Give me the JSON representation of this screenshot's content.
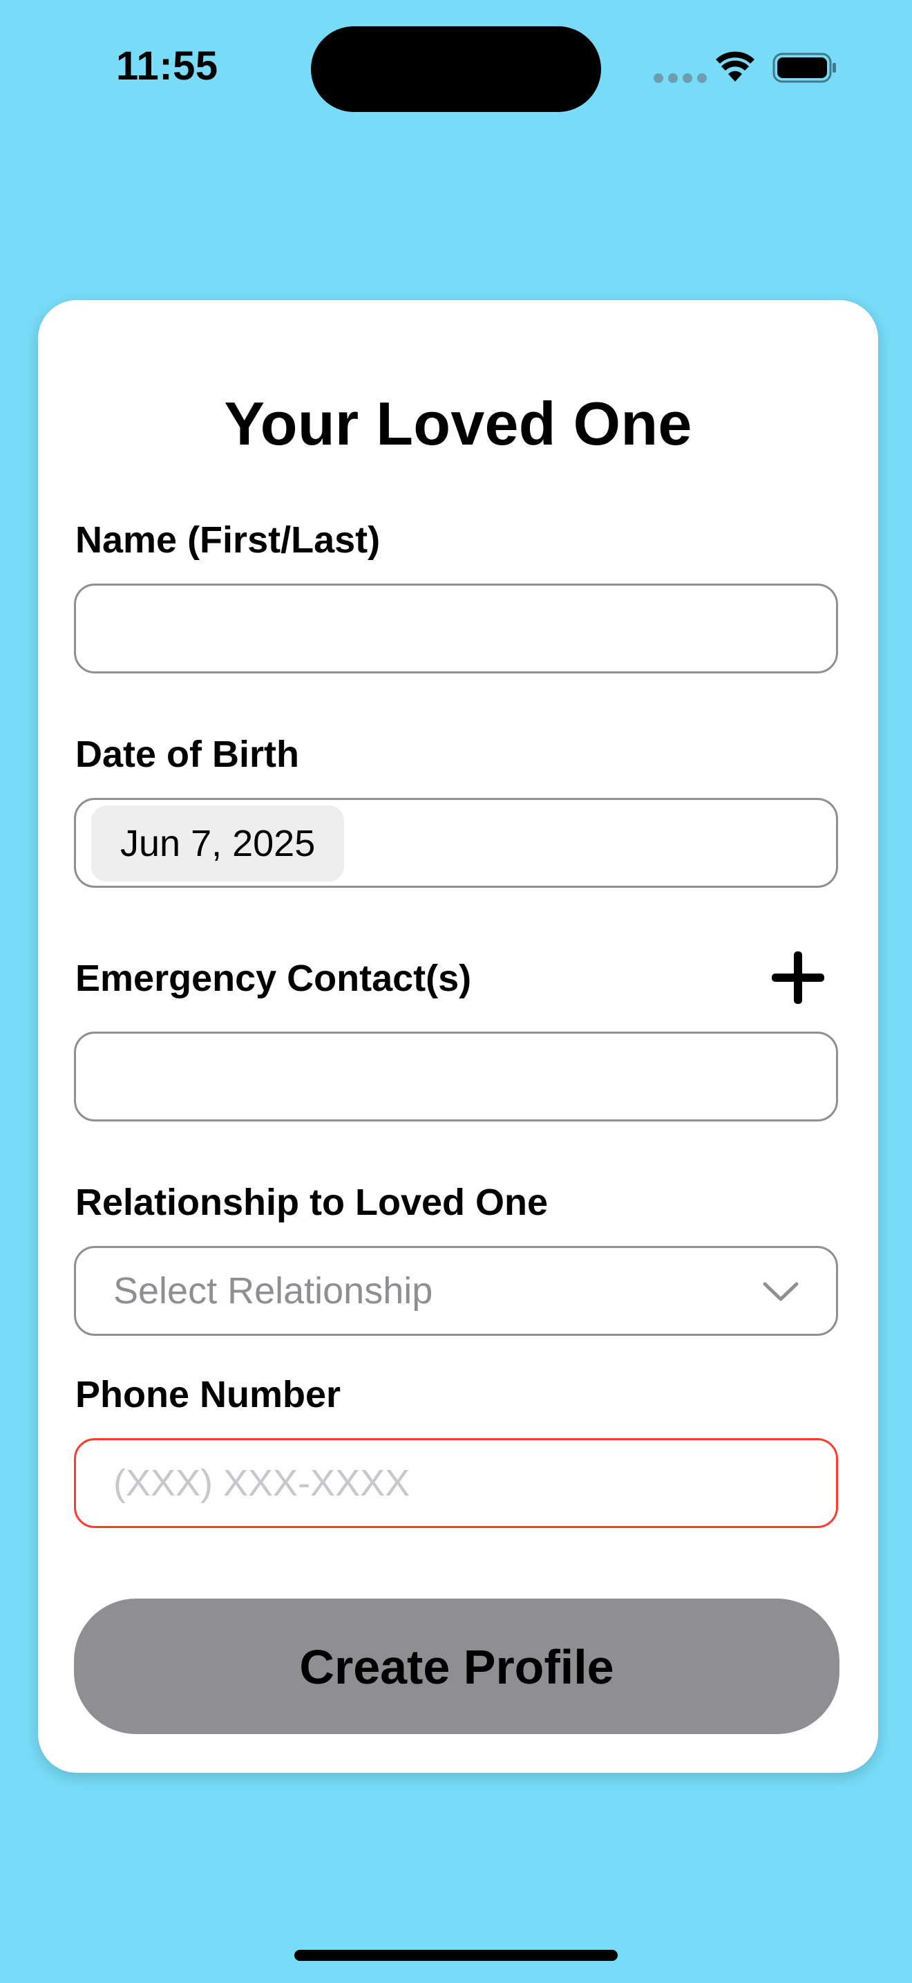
{
  "status_bar": {
    "time": "11:55"
  },
  "form": {
    "title": "Your Loved One",
    "name_label": "Name (First/Last)",
    "name_value": "",
    "dob_label": "Date of Birth",
    "dob_value": "Jun 7, 2025",
    "emergency_label": "Emergency Contact(s)",
    "emergency_value": "",
    "relationship_label": "Relationship to Loved One",
    "relationship_selected": "Select Relationship",
    "phone_label": "Phone Number",
    "phone_placeholder": "(XXX) XXX-XXXX",
    "phone_value": "",
    "submit_label": "Create Profile"
  },
  "colors": {
    "background": "#78dcf8",
    "card": "#ffffff",
    "button": "#8e8e93",
    "error_border": "#ff3b30"
  },
  "icons": {
    "add": "plus-icon",
    "dropdown": "chevron-down-icon",
    "wifi": "wifi-icon",
    "battery": "battery-icon"
  }
}
